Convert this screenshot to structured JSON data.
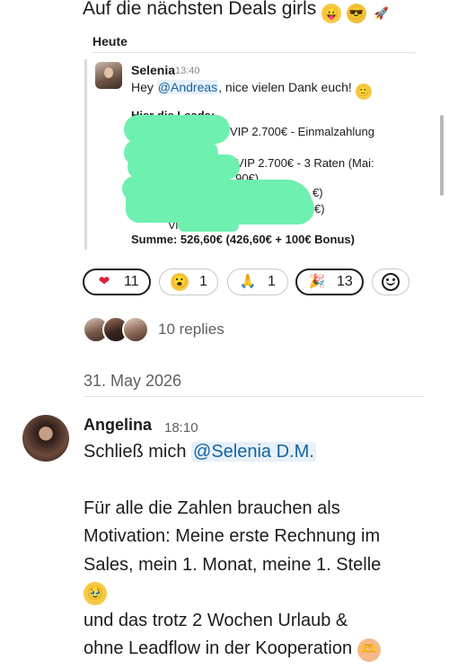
{
  "top_message": {
    "text": "Auf die nächsten Deals girls",
    "emojis": [
      "😛",
      "😎",
      "🚀"
    ]
  },
  "quoted_message": {
    "date_header": "Heute",
    "author": "Selenia",
    "time": "13:40",
    "text_before": "Hey ",
    "mention": "@Andreas",
    "text_after": ", nice vielen Dank euch! ",
    "emoji": "🙂",
    "leads_heading": "Hier die Leads:",
    "lines": [
      "VIP 2.700€ - Einmalzahlung",
      "- VIP 2.700€ - 3 Raten (Mai:",
      "i: 90€)",
      "€)",
      "€)",
      "Vi"
    ],
    "sum_line": "Summe: 526,60€ (426,60€ + 100€ Bonus)"
  },
  "reactions": [
    {
      "icon": "heart-icon",
      "glyph": "❤",
      "count": "11",
      "active": true
    },
    {
      "icon": "surprised-face-icon",
      "glyph": "😮",
      "count": "1",
      "active": false
    },
    {
      "icon": "praying-hands-icon",
      "glyph": "🙏",
      "count": "1",
      "active": false
    },
    {
      "icon": "party-popper-icon",
      "glyph": "🎉",
      "count": "13",
      "active": true
    }
  ],
  "replies": {
    "label": "10 replies"
  },
  "day_divider": {
    "label": "31. May 2026"
  },
  "message": {
    "author": "Angelina",
    "time": "18:10",
    "line1_prefix": "Schließ mich ",
    "mention": "@Selenia D.M.",
    "line2": "Für alle die Zahlen brauchen als",
    "line3": "Motivation: Meine erste Rechnung im",
    "line4": "Sales, mein 1. Monat, meine 1. Stelle",
    "line5_emoji": "🥹",
    "line6": "und das trotz 2 Wochen Urlaub &",
    "line7": "ohne Leadflow in der Kooperation",
    "line7_emoji": "🫶"
  },
  "colors": {
    "mention": "#1264a3",
    "redaction": "#6ef0b0",
    "muted": "#616061"
  }
}
